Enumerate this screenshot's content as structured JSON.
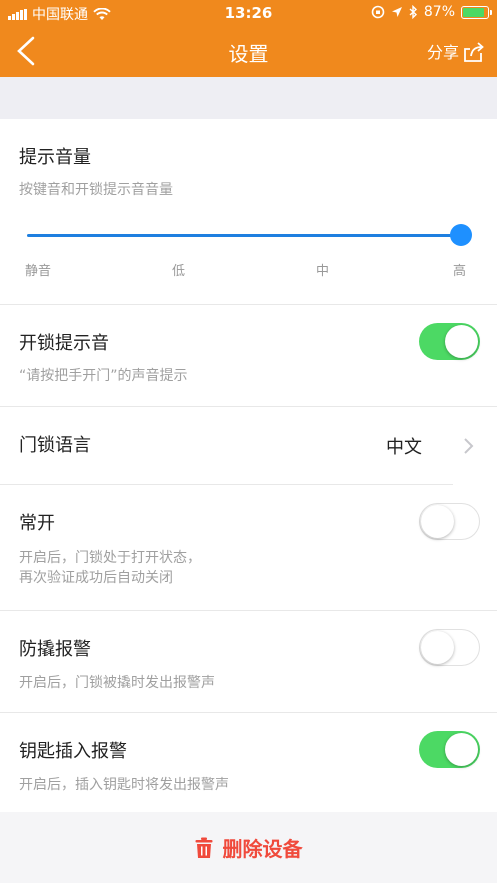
{
  "status_bar": {
    "carrier": "中国联通",
    "time": "13:26",
    "battery_percent": "87%",
    "battery_level": 0.87
  },
  "nav": {
    "title": "设置",
    "share_label": "分享"
  },
  "volume": {
    "title": "提示音量",
    "subtitle": "按键音和开锁提示音音量",
    "ticks": [
      "静音",
      "低",
      "中",
      "高"
    ],
    "level_index": 3
  },
  "unlock_sound": {
    "title": "开锁提示音",
    "subtitle": "“请按把手开门”的声音提示",
    "enabled": true
  },
  "language": {
    "title": "门锁语言",
    "value": "中文"
  },
  "always_open": {
    "title": "常开",
    "subtitle_line1": "开启后，门锁处于打开状态，",
    "subtitle_line2": "再次验证成功后自动关闭",
    "enabled": false
  },
  "tamper_alarm": {
    "title": "防撬报警",
    "subtitle": "开启后，门锁被撬时发出报警声",
    "enabled": false
  },
  "key_alarm": {
    "title": "钥匙插入报警",
    "subtitle": "开启后，插入钥匙时将发出报警声",
    "enabled": true
  },
  "delete": {
    "label": "删除设备"
  },
  "colors": {
    "accent": "#f0891d",
    "toggle_on": "#4cd964",
    "slider": "#1e90ff",
    "danger": "#f04a3c"
  },
  "icons": {
    "back": "chevron-left-icon",
    "share": "share-icon",
    "wifi": "wifi-icon",
    "bluetooth": "bluetooth-icon",
    "location": "location-arrow-icon",
    "lock_rotation": "rotation-lock-icon",
    "trash": "trash-icon"
  }
}
